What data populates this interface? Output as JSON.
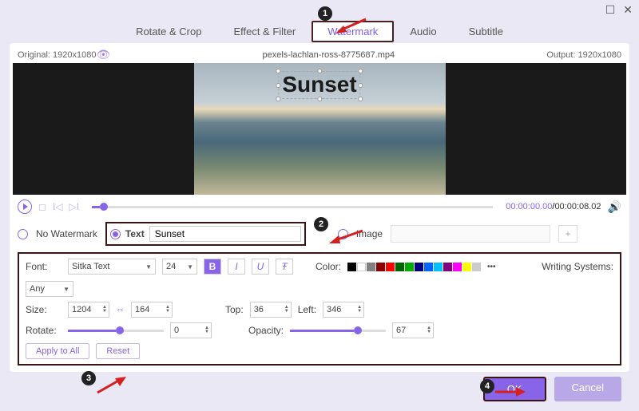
{
  "window": {
    "maximize": "☐",
    "close": "✕"
  },
  "tabs": {
    "rotate": "Rotate & Crop",
    "effect": "Effect & Filter",
    "watermark": "Watermark",
    "audio": "Audio",
    "subtitle": "Subtitle"
  },
  "info": {
    "original_label": "Original: 1920x1080",
    "filename": "pexels-lachlan-ross-8775687.mp4",
    "output_label": "Output: 1920x1080"
  },
  "watermark_overlay": "Sunset",
  "time": {
    "current": "00:00:00.00",
    "sep": "/",
    "duration": "00:00:08.02"
  },
  "wm": {
    "none": "No Watermark",
    "text_label": "Text",
    "text_value": "Sunset",
    "image_label": "Image",
    "plus": "+"
  },
  "props": {
    "font_label": "Font:",
    "font_value": "Sitka Text",
    "font_size": "24",
    "color_label": "Color:",
    "swatches": [
      "#000000",
      "#ffffff",
      "#808080",
      "#8b0000",
      "#ff0000",
      "#006400",
      "#00aa00",
      "#000080",
      "#0066ff",
      "#00bfff",
      "#800080",
      "#ff00ff",
      "#ffff00",
      "#cccccc"
    ],
    "more": "•••",
    "ws_label": "Writing Systems:",
    "ws_value": "Any",
    "size_label": "Size:",
    "size_w": "1204",
    "size_h": "164",
    "top_label": "Top:",
    "top": "36",
    "left_label": "Left:",
    "left": "346",
    "rotate_label": "Rotate:",
    "rotate": "0",
    "opacity_label": "Opacity:",
    "opacity": "67",
    "apply": "Apply to All",
    "reset": "Reset"
  },
  "footer": {
    "ok": "OK",
    "cancel": "Cancel"
  },
  "badges": {
    "b1": "1",
    "b2": "2",
    "b3": "3",
    "b4": "4"
  }
}
